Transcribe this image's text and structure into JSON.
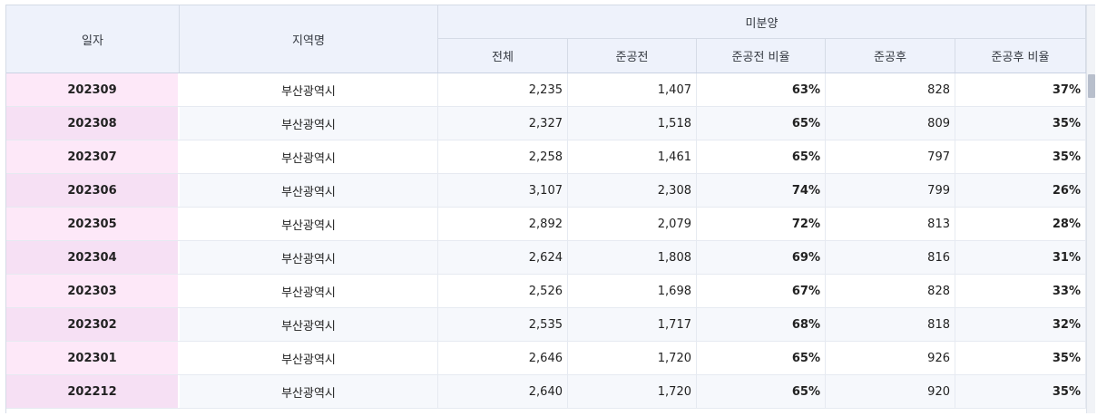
{
  "table": {
    "headers": {
      "date": "일자",
      "region": "지역명",
      "group": "미분양",
      "total": "전체",
      "before": "준공전",
      "before_ratio": "준공전 비율",
      "after": "준공후",
      "after_ratio": "준공후 비율"
    },
    "colors": {
      "date_cell_odd": "#fde8f8",
      "date_cell_even": "#f6e0f4",
      "header_bg": "#eef2fb"
    },
    "rows": [
      {
        "date": "202309",
        "region": "부산광역시",
        "total": "2,235",
        "before": "1,407",
        "before_ratio": "63%",
        "after": "828",
        "after_ratio": "37%"
      },
      {
        "date": "202308",
        "region": "부산광역시",
        "total": "2,327",
        "before": "1,518",
        "before_ratio": "65%",
        "after": "809",
        "after_ratio": "35%"
      },
      {
        "date": "202307",
        "region": "부산광역시",
        "total": "2,258",
        "before": "1,461",
        "before_ratio": "65%",
        "after": "797",
        "after_ratio": "35%"
      },
      {
        "date": "202306",
        "region": "부산광역시",
        "total": "3,107",
        "before": "2,308",
        "before_ratio": "74%",
        "after": "799",
        "after_ratio": "26%"
      },
      {
        "date": "202305",
        "region": "부산광역시",
        "total": "2,892",
        "before": "2,079",
        "before_ratio": "72%",
        "after": "813",
        "after_ratio": "28%"
      },
      {
        "date": "202304",
        "region": "부산광역시",
        "total": "2,624",
        "before": "1,808",
        "before_ratio": "69%",
        "after": "816",
        "after_ratio": "31%"
      },
      {
        "date": "202303",
        "region": "부산광역시",
        "total": "2,526",
        "before": "1,698",
        "before_ratio": "67%",
        "after": "828",
        "after_ratio": "33%"
      },
      {
        "date": "202302",
        "region": "부산광역시",
        "total": "2,535",
        "before": "1,717",
        "before_ratio": "68%",
        "after": "818",
        "after_ratio": "32%"
      },
      {
        "date": "202301",
        "region": "부산광역시",
        "total": "2,646",
        "before": "1,720",
        "before_ratio": "65%",
        "after": "926",
        "after_ratio": "35%"
      },
      {
        "date": "202212",
        "region": "부산광역시",
        "total": "2,640",
        "before": "1,720",
        "before_ratio": "65%",
        "after": "920",
        "after_ratio": "35%"
      }
    ]
  }
}
